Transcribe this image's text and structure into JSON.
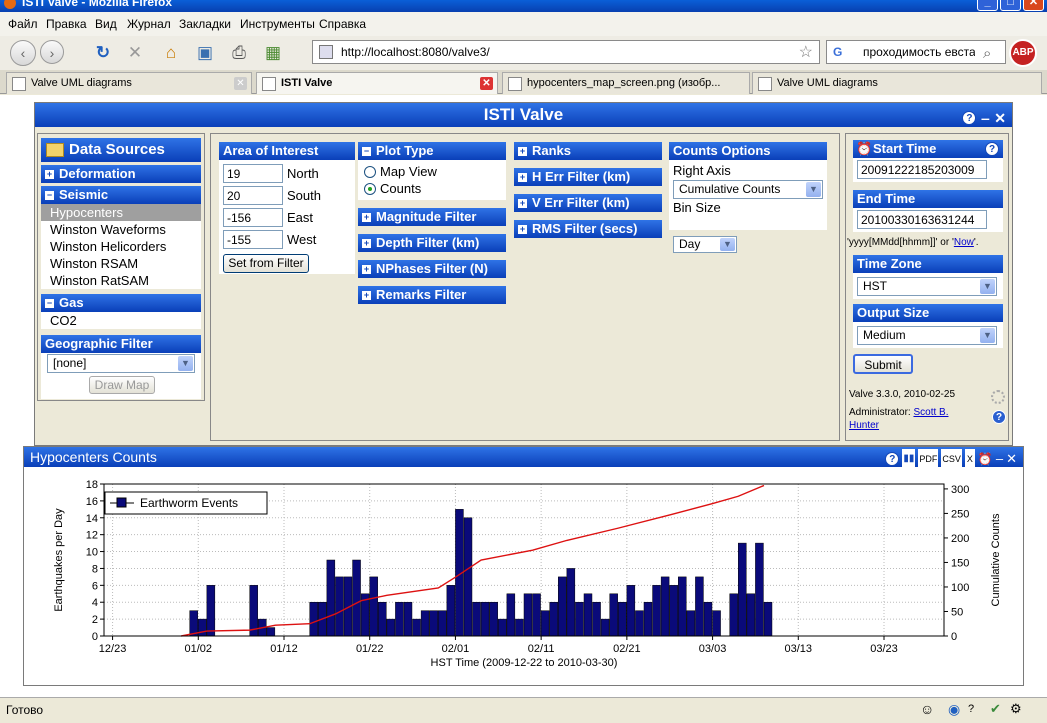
{
  "window": {
    "title": "ISTI Valve - Mozilla Firefox"
  },
  "menu": [
    "Файл",
    "Правка",
    "Вид",
    "Журнал",
    "Закладки",
    "Инструменты",
    "Справка"
  ],
  "nav": {
    "url": "http://localhost:8080/valve3/",
    "search": "проходимость евстахи"
  },
  "tabs": [
    {
      "label": "Valve UML diagrams",
      "active": false
    },
    {
      "label": "ISTI Valve",
      "active": true
    },
    {
      "label": "hypocenters_map_screen.png (изобр...",
      "active": false
    },
    {
      "label": "Valve UML diagrams",
      "active": false
    }
  ],
  "app": {
    "title": "ISTI Valve"
  },
  "sources": {
    "title": "Data Sources",
    "deformation": "Deformation",
    "seismic": "Seismic",
    "seismic_items": [
      "Hypocenters",
      "Winston Waveforms",
      "Winston Helicorders",
      "Winston RSAM",
      "Winston RatSAM"
    ],
    "gas": "Gas",
    "gas_items": [
      "CO2"
    ],
    "geo_filter": "Geographic Filter",
    "geo_value": "[none]",
    "draw_map": "Draw Map"
  },
  "aoi": {
    "title": "Area of Interest",
    "fields": [
      {
        "value": "19",
        "label": "North"
      },
      {
        "value": "20",
        "label": "South"
      },
      {
        "value": "-156",
        "label": "East"
      },
      {
        "value": "-155",
        "label": "West"
      }
    ],
    "button": "Set from Filter"
  },
  "plot_type": {
    "title": "Plot Type",
    "options": [
      "Map View",
      "Counts"
    ],
    "selected": "Counts"
  },
  "filters": [
    "Magnitude Filter",
    "Depth Filter (km)",
    "NPhases Filter (N)",
    "Remarks Filter"
  ],
  "filters2": [
    "Ranks",
    "H Err Filter (km)",
    "V Err Filter (km)",
    "RMS Filter (secs)"
  ],
  "counts": {
    "title": "Counts Options",
    "right_axis_label": "Right Axis",
    "right_axis_value": "Cumulative Counts",
    "bin_label": "Bin Size",
    "bin_value": "Day"
  },
  "time": {
    "start_title": "Start Time",
    "start_value": "20091222185203009",
    "end_title": "End Time",
    "end_value": "20100330163631244",
    "hint_a": "'yyyy[MMdd[hhmm]]' or '",
    "hint_now": "Now",
    "hint_b": "'.",
    "tz_title": "Time Zone",
    "tz_value": "HST",
    "size_title": "Output Size",
    "size_value": "Medium",
    "submit": "Submit"
  },
  "version": {
    "text": "Valve 3.3.0, 2010-02-25",
    "admin_label": "Administrator:",
    "admin_name": "Scott B. Hunter"
  },
  "plot": {
    "title": "Hypocenters Counts",
    "toolbar": [
      "PDF",
      "CSV",
      "X"
    ]
  },
  "status": "Готово",
  "chart_data": {
    "type": "bar",
    "legend": "Earthworm Events",
    "ylabel": "Earthquakes per Day",
    "y2label": "Cumulative Counts",
    "xlabel": "HST Time (2009-12-22 to 2010-03-30)",
    "ylim": [
      0,
      18
    ],
    "y2lim": [
      0,
      310
    ],
    "yticks": [
      0,
      2,
      4,
      6,
      8,
      10,
      12,
      14,
      16,
      18
    ],
    "y2ticks": [
      0,
      50,
      100,
      150,
      200,
      250,
      300
    ],
    "xticks": [
      "12/23",
      "01/02",
      "01/12",
      "01/22",
      "02/01",
      "02/11",
      "02/21",
      "03/03",
      "03/13",
      "03/23"
    ],
    "x_start": "2009-12-22",
    "x_end": "2010-03-30",
    "bars": [
      {
        "date": "2010-01-01",
        "value": 3
      },
      {
        "date": "2010-01-02",
        "value": 2
      },
      {
        "date": "2010-01-03",
        "value": 6
      },
      {
        "date": "2010-01-08",
        "value": 6
      },
      {
        "date": "2010-01-09",
        "value": 2
      },
      {
        "date": "2010-01-10",
        "value": 1
      },
      {
        "date": "2010-01-15",
        "value": 4
      },
      {
        "date": "2010-01-16",
        "value": 4
      },
      {
        "date": "2010-01-17",
        "value": 9
      },
      {
        "date": "2010-01-18",
        "value": 7
      },
      {
        "date": "2010-01-19",
        "value": 7
      },
      {
        "date": "2010-01-20",
        "value": 9
      },
      {
        "date": "2010-01-21",
        "value": 5
      },
      {
        "date": "2010-01-22",
        "value": 7
      },
      {
        "date": "2010-01-23",
        "value": 4
      },
      {
        "date": "2010-01-24",
        "value": 2
      },
      {
        "date": "2010-01-25",
        "value": 4
      },
      {
        "date": "2010-01-26",
        "value": 4
      },
      {
        "date": "2010-01-27",
        "value": 2
      },
      {
        "date": "2010-01-28",
        "value": 3
      },
      {
        "date": "2010-01-29",
        "value": 3
      },
      {
        "date": "2010-01-30",
        "value": 3
      },
      {
        "date": "2010-01-31",
        "value": 6
      },
      {
        "date": "2010-02-01",
        "value": 15
      },
      {
        "date": "2010-02-02",
        "value": 14
      },
      {
        "date": "2010-02-03",
        "value": 4
      },
      {
        "date": "2010-02-04",
        "value": 4
      },
      {
        "date": "2010-02-05",
        "value": 4
      },
      {
        "date": "2010-02-06",
        "value": 2
      },
      {
        "date": "2010-02-07",
        "value": 5
      },
      {
        "date": "2010-02-08",
        "value": 2
      },
      {
        "date": "2010-02-09",
        "value": 5
      },
      {
        "date": "2010-02-10",
        "value": 5
      },
      {
        "date": "2010-02-11",
        "value": 3
      },
      {
        "date": "2010-02-12",
        "value": 4
      },
      {
        "date": "2010-02-13",
        "value": 7
      },
      {
        "date": "2010-02-14",
        "value": 8
      },
      {
        "date": "2010-02-15",
        "value": 4
      },
      {
        "date": "2010-02-16",
        "value": 5
      },
      {
        "date": "2010-02-17",
        "value": 4
      },
      {
        "date": "2010-02-18",
        "value": 2
      },
      {
        "date": "2010-02-19",
        "value": 5
      },
      {
        "date": "2010-02-20",
        "value": 4
      },
      {
        "date": "2010-02-21",
        "value": 6
      },
      {
        "date": "2010-02-22",
        "value": 3
      },
      {
        "date": "2010-02-23",
        "value": 4
      },
      {
        "date": "2010-02-24",
        "value": 6
      },
      {
        "date": "2010-02-25",
        "value": 7
      },
      {
        "date": "2010-02-26",
        "value": 6
      },
      {
        "date": "2010-02-27",
        "value": 7
      },
      {
        "date": "2010-02-28",
        "value": 3
      },
      {
        "date": "2010-03-01",
        "value": 7
      },
      {
        "date": "2010-03-02",
        "value": 4
      },
      {
        "date": "2010-03-03",
        "value": 3
      },
      {
        "date": "2010-03-05",
        "value": 5
      },
      {
        "date": "2010-03-06",
        "value": 11
      },
      {
        "date": "2010-03-07",
        "value": 5
      },
      {
        "date": "2010-03-08",
        "value": 11
      },
      {
        "date": "2010-03-09",
        "value": 4
      }
    ],
    "cumulative": [
      {
        "date": "2009-12-31",
        "value": 0
      },
      {
        "date": "2010-01-03",
        "value": 10
      },
      {
        "date": "2010-01-08",
        "value": 12
      },
      {
        "date": "2010-01-11",
        "value": 22
      },
      {
        "date": "2010-01-15",
        "value": 25
      },
      {
        "date": "2010-01-18",
        "value": 45
      },
      {
        "date": "2010-01-21",
        "value": 72
      },
      {
        "date": "2010-01-24",
        "value": 83
      },
      {
        "date": "2010-01-30",
        "value": 98
      },
      {
        "date": "2010-02-01",
        "value": 120
      },
      {
        "date": "2010-02-04",
        "value": 155
      },
      {
        "date": "2010-02-10",
        "value": 175
      },
      {
        "date": "2010-02-14",
        "value": 195
      },
      {
        "date": "2010-02-20",
        "value": 220
      },
      {
        "date": "2010-02-26",
        "value": 247
      },
      {
        "date": "2010-03-03",
        "value": 270
      },
      {
        "date": "2010-03-06",
        "value": 285
      },
      {
        "date": "2010-03-09",
        "value": 307
      }
    ]
  }
}
